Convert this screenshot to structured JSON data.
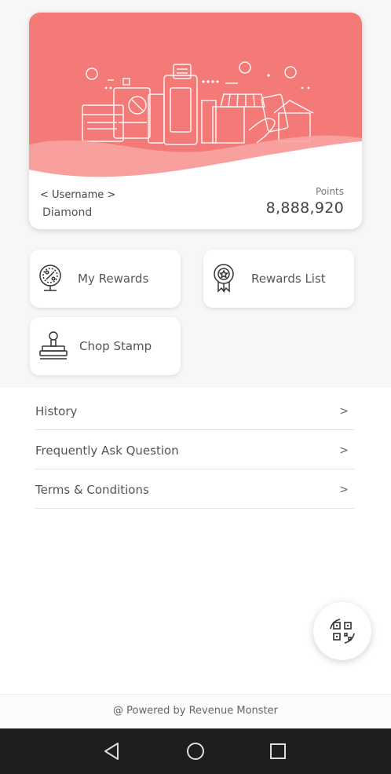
{
  "card": {
    "username": "< Username >",
    "tier": "Diamond",
    "points_label": "Points",
    "points_value": "8,888,920",
    "banner_color": "#f47a78"
  },
  "tiles": [
    {
      "label": "My Rewards",
      "icon": "discount-coupon-icon"
    },
    {
      "label": "Rewards List",
      "icon": "award-ribbon-icon"
    },
    {
      "label": "Chop Stamp",
      "icon": "rubber-stamp-icon"
    }
  ],
  "menu": [
    {
      "label": "History",
      "arrow": ">"
    },
    {
      "label": "Frequently Ask Question",
      "arrow": ">"
    },
    {
      "label": "Terms & Conditions",
      "arrow": ">"
    }
  ],
  "fab": {
    "icon": "qr-scan-icon"
  },
  "footer": {
    "text": "@ Powered by Revenue Monster"
  },
  "navbar": {
    "back_icon": "back-triangle-icon",
    "home_icon": "home-circle-icon",
    "recents_icon": "recents-square-icon"
  }
}
